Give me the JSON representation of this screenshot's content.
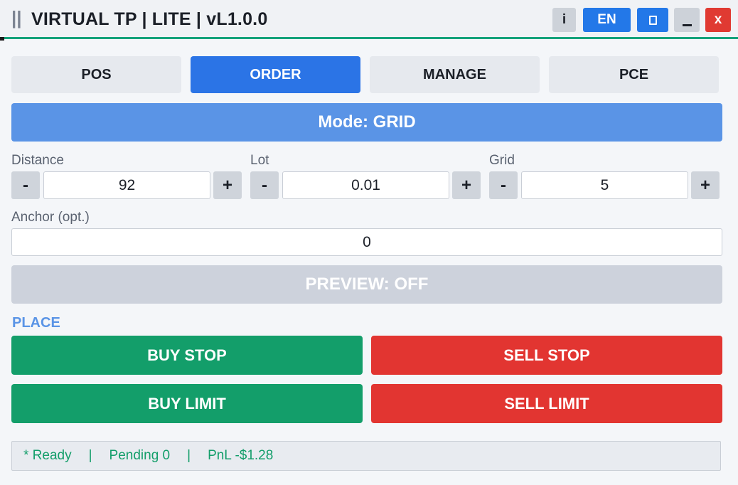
{
  "window": {
    "grip": "||",
    "title": "VIRTUAL TP | LITE | vL1.0.0",
    "info_label": "i",
    "lang_label": "EN",
    "minimize_icon": "minimize-icon",
    "maximize_icon": "maximize-icon",
    "close_label": "x"
  },
  "tabs": [
    {
      "label": "POS",
      "active": false
    },
    {
      "label": "ORDER",
      "active": true
    },
    {
      "label": "MANAGE",
      "active": false
    },
    {
      "label": "PCE",
      "active": false
    }
  ],
  "mode": "Mode: GRID",
  "params": {
    "distance": {
      "label": "Distance",
      "value": "92",
      "minus": "-",
      "plus": "+"
    },
    "lot": {
      "label": "Lot",
      "value": "0.01",
      "minus": "-",
      "plus": "+"
    },
    "grid": {
      "label": "Grid",
      "value": "5",
      "minus": "-",
      "plus": "+"
    }
  },
  "anchor": {
    "label": "Anchor (opt.)",
    "value": "0"
  },
  "preview": "PREVIEW: OFF",
  "place": {
    "heading": "PLACE",
    "buy_stop": "BUY STOP",
    "sell_stop": "SELL STOP",
    "buy_limit": "BUY LIMIT",
    "sell_limit": "SELL LIMIT"
  },
  "status": {
    "ready": "* Ready",
    "sep": "|",
    "pending": "Pending 0",
    "pnl": "PnL -$1.28"
  },
  "colors": {
    "accent": "#2b74e6",
    "buy": "#139e6a",
    "sell": "#e23531",
    "divider": "#14a27a"
  }
}
